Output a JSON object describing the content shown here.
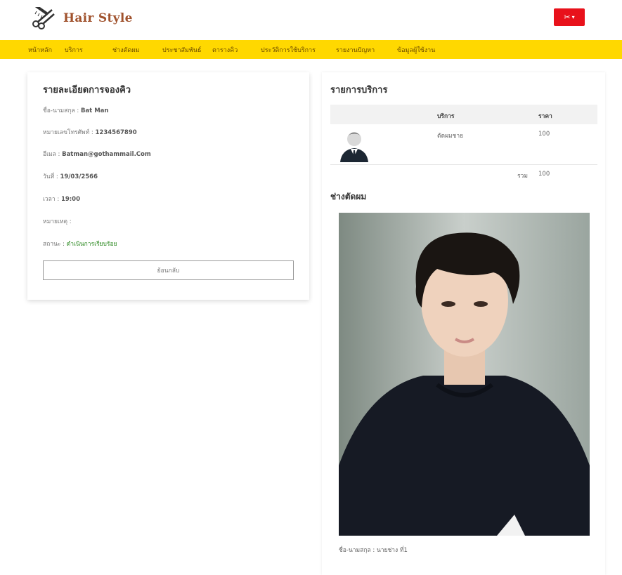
{
  "header": {
    "brand": "Hair Style",
    "user_menu_icon": "scissors-icon",
    "user_menu_chevron": "chevron-down-icon",
    "user_menu_color": "#e8111b"
  },
  "nav": {
    "items": [
      "หน้าหลัก",
      "บริการ",
      "ช่างตัดผม",
      "ประชาสัมพันธ์",
      "ตารางคิว",
      "ประวัติการใช้บริการ",
      "รายงานปัญหา",
      "ข้อมูลผู้ใช้งาน"
    ],
    "bg_color": "#ffd800"
  },
  "booking": {
    "title": "รายละเอียดการจองคิว",
    "name_label": "ชื่อ-นามสกุล : ",
    "name_value": "Bat Man",
    "phone_label": "หมายเลขโทรศัพท์ : ",
    "phone_value": "1234567890",
    "email_label": "อีเมล : ",
    "email_value": "Batman@gothammail.Com",
    "date_label": "วันที่ : ",
    "date_value": "19/03/2566",
    "time_label": "เวลา : ",
    "time_value": "19:00",
    "note_label": "หมายเหตุ :",
    "status_label": "สถานะ : ",
    "status_value": "ดำเนินการเรียบร้อย",
    "status_color": "#2e8b23",
    "back_button": "ย้อนกลับ"
  },
  "services": {
    "title": "รายการบริการ",
    "col_service": "บริการ",
    "col_price": "ราคา",
    "rows": [
      {
        "service": "ตัดผมชาย",
        "price": "100"
      }
    ],
    "total_label": "รวม",
    "total_value": "100"
  },
  "barber": {
    "title": "ช่างตัดผม",
    "name_label": "ชื่อ-นามสกุล : ",
    "name_value": "นายช่าง ที่1"
  }
}
